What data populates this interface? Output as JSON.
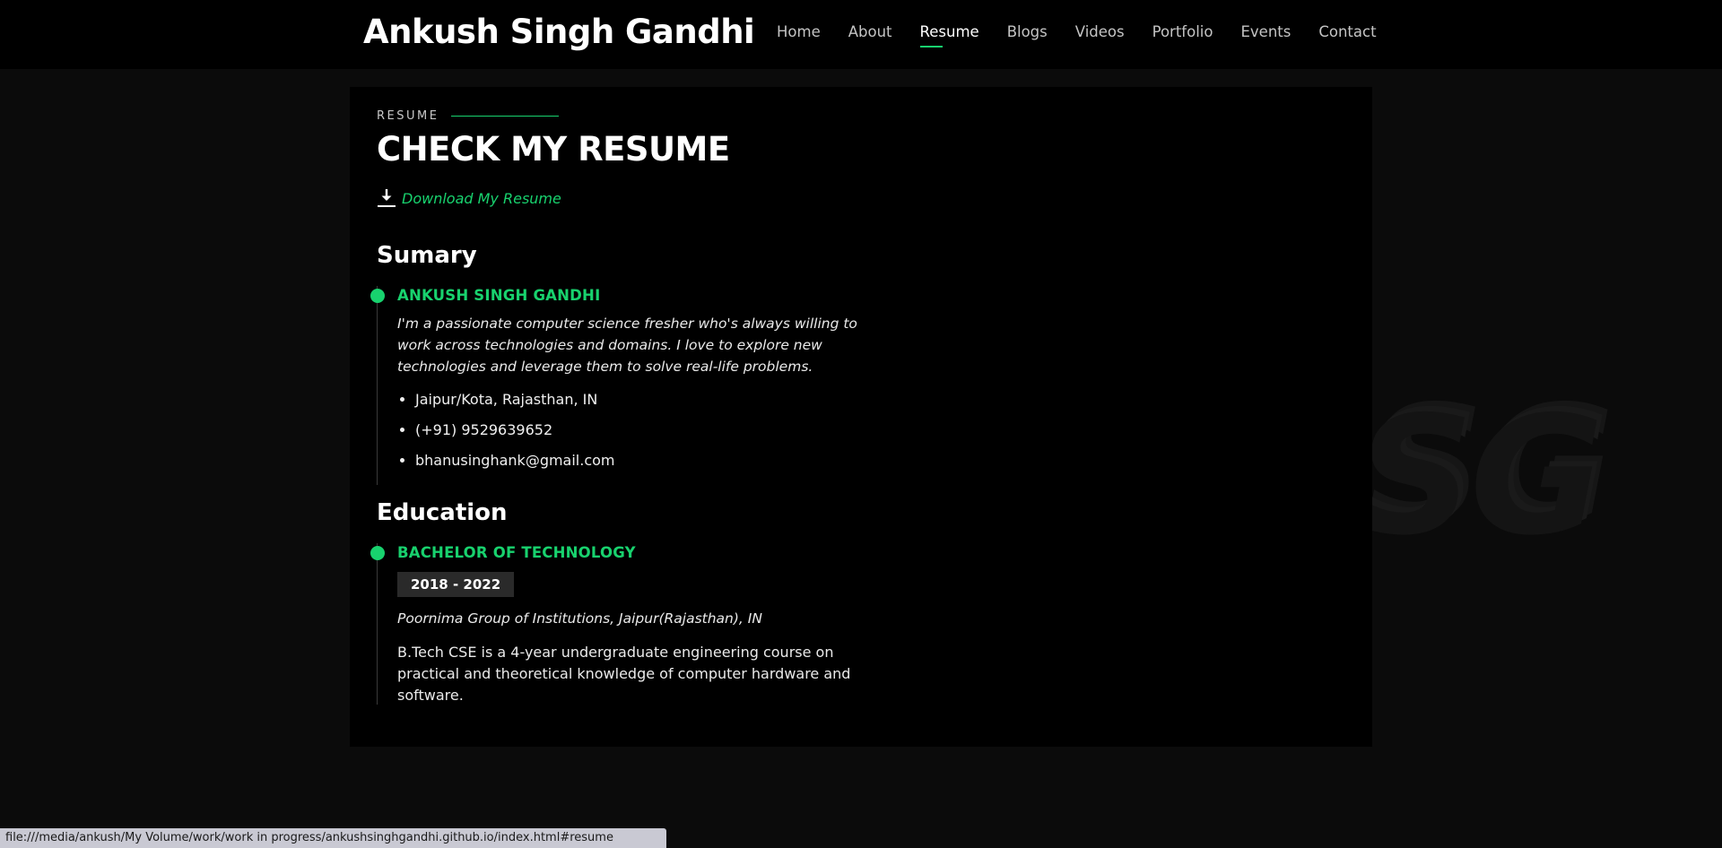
{
  "header": {
    "brand": "Ankush Singh Gandhi",
    "nav": [
      {
        "label": "Home",
        "active": false
      },
      {
        "label": "About",
        "active": false
      },
      {
        "label": "Resume",
        "active": true
      },
      {
        "label": "Blogs",
        "active": false
      },
      {
        "label": "Videos",
        "active": false
      },
      {
        "label": "Portfolio",
        "active": false
      },
      {
        "label": "Events",
        "active": false
      },
      {
        "label": "Contact",
        "active": false
      }
    ]
  },
  "resume": {
    "kicker": "RESUME",
    "title": "CHECK MY RESUME",
    "download_label": "Download My Resume",
    "summary": {
      "heading": "Sumary",
      "name": "ANKUSH SINGH GANDHI",
      "bio": "I'm a passionate computer science fresher who's always willing to work across technologies and domains. I love to explore new technologies and leverage them to solve real-life problems.",
      "contacts": [
        "Jaipur/Kota, Rajasthan, IN",
        "(+91) 9529639652",
        "bhanusinghank@gmail.com"
      ]
    },
    "education": {
      "heading": "Education",
      "degree": "BACHELOR OF TECHNOLOGY",
      "years": "2018 - 2022",
      "institution": "Poornima Group of Institutions, Jaipur(Rajasthan), IN",
      "description": "B.Tech CSE is a 4-year undergraduate engineering course on practical and theoretical knowledge of computer hardware and software."
    }
  },
  "watermark": "ASG",
  "statusbar": {
    "url": "file:///media/ankush/My Volume/work/work in progress/ankushsinghgandhi.github.io/index.html#resume"
  },
  "colors": {
    "accent": "#18d26e",
    "background": "#0b0b0b",
    "card": "#000000"
  },
  "icons": {
    "download": "download-icon"
  }
}
